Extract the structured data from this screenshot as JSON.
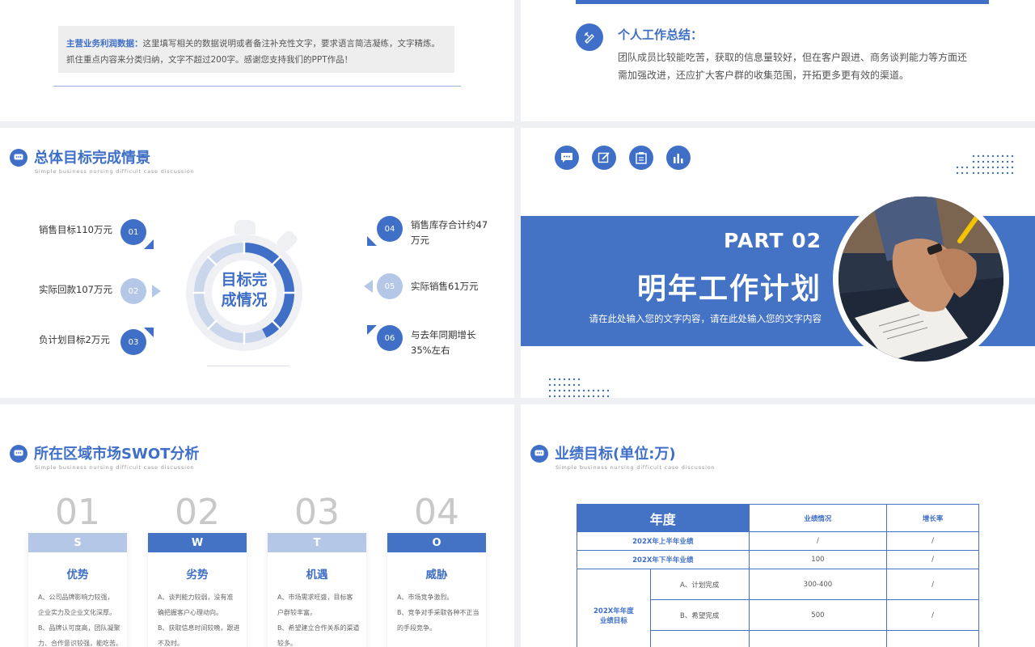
{
  "slide1": {
    "note_label": "主营业务利润数据：",
    "note_text": "这里填写相关的数据说明或者备注补充性文字，要求语言简洁凝练，文字精炼。抓住重点内容来分类归纳，文字不超过200字。感谢您支持我们的PPT作品！"
  },
  "slide2": {
    "title": "个人工作总结：",
    "text": "团队成员比较能吃苦，获取的信息量较好，但在客户跟进、商务谈判能力等方面还需加强改进，还应扩大客户群的收集范围，开拓更多更有效的渠道。",
    "icon": "pencil-ruler-icon"
  },
  "slide3": {
    "title": "总体目标完成情景",
    "subtitle": "Simple business nursing difficult case discussion",
    "center_line1": "目标完",
    "center_line2": "成情况",
    "items": [
      {
        "num": "01",
        "text": "销售目标110万元"
      },
      {
        "num": "02",
        "text": "实际回款107万元"
      },
      {
        "num": "03",
        "text": "负计划目标2万元"
      },
      {
        "num": "04",
        "text_line1": "销售库存合计约47",
        "text_line2": "万元"
      },
      {
        "num": "05",
        "text": "实际销售61万元"
      },
      {
        "num": "06",
        "text_line1": "与去年同期增长",
        "text_line2": "35%左右"
      }
    ]
  },
  "slide4": {
    "part": "PART 02",
    "title": "明年工作计划",
    "subtitle": "请在此处输入您的文字内容，请在此处输入您的文字内容",
    "icons": [
      "chat-icon",
      "edit-icon",
      "clipboard-icon",
      "bar-chart-icon"
    ]
  },
  "slide5": {
    "title": "所在区域市场SWOT分析",
    "subtitle": "Simple business nursing difficult case discussion",
    "cards": [
      {
        "num": "01",
        "letter": "S",
        "name": "优势",
        "lines": [
          "A、公司品牌影响力较强，",
          "企业实力及企业文化深厚。",
          "B、品牌认可度高，团队凝聚",
          "力、合作意识较强，能吃苦。"
        ]
      },
      {
        "num": "02",
        "letter": "W",
        "name": "劣势",
        "lines": [
          "A、谈判能力较弱，没有准",
          "确把握客户心理动向。",
          "B、获取信息时间较晚，跟进",
          "不及时。"
        ]
      },
      {
        "num": "03",
        "letter": "T",
        "name": "机遇",
        "lines": [
          "A、市场需求旺盛，目标客",
          "户群较丰富。",
          "B、希望建立合作关系的渠道",
          "较多。"
        ]
      },
      {
        "num": "04",
        "letter": "O",
        "name": "威胁",
        "lines": [
          "A、市场竞争激烈。",
          "B、竞争对手采取各种不正当",
          "的手段竞争。"
        ]
      }
    ]
  },
  "slide6": {
    "title": "业绩目标(单位:万)",
    "subtitle": "Simple business nursing difficult case discussion",
    "headers": [
      "年度",
      "业绩情况",
      "增长率"
    ],
    "rows": [
      {
        "label": "202X年上半年业绩",
        "value": "/",
        "rate": "/"
      },
      {
        "label": "202X年下半年业绩",
        "value": "100",
        "rate": "/"
      }
    ],
    "group_label_line1": "202X年年度",
    "group_label_line2": "业绩目标",
    "sub_rows": [
      {
        "label": "A、计划完成",
        "value": "300-400",
        "rate": "/"
      },
      {
        "label": "B、希望完成",
        "value": "500",
        "rate": "/"
      }
    ]
  }
}
